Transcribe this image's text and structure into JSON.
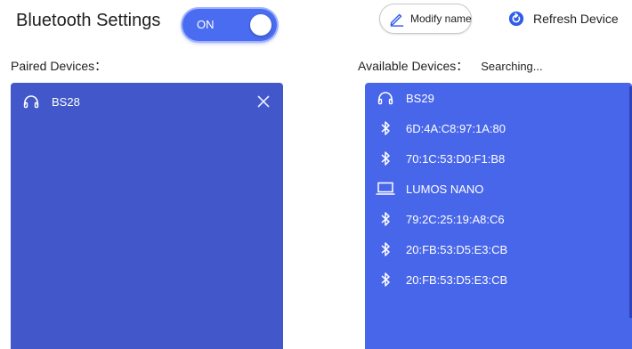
{
  "header": {
    "title": "Bluetooth Settings",
    "toggle_label": "ON",
    "toggle_state": "on",
    "modify_name_label": "Modify name",
    "refresh_label": "Refresh Device"
  },
  "paired": {
    "label": "Paired Devices：",
    "devices": [
      {
        "name": "BS28",
        "icon": "headphones-icon"
      }
    ]
  },
  "available": {
    "label": "Available Devices：",
    "status": "Searching...",
    "devices": [
      {
        "name": "BS29",
        "icon": "headphones-icon"
      },
      {
        "name": "6D:4A:C8:97:1A:80",
        "icon": "bluetooth-icon"
      },
      {
        "name": "70:1C:53:D0:F1:B8",
        "icon": "bluetooth-icon"
      },
      {
        "name": "LUMOS NANO",
        "icon": "laptop-icon"
      },
      {
        "name": "79:2C:25:19:A8:C6",
        "icon": "bluetooth-icon"
      },
      {
        "name": "20:FB:53:D5:E3:CB",
        "icon": "bluetooth-icon"
      },
      {
        "name": "20:FB:53:D5:E3:CB",
        "icon": "bluetooth-icon"
      }
    ]
  },
  "colors": {
    "paired_panel": "#4257c9",
    "available_panel": "#4866ea",
    "toggle_on": "#4a6cf0",
    "accent": "#2f5de8"
  }
}
